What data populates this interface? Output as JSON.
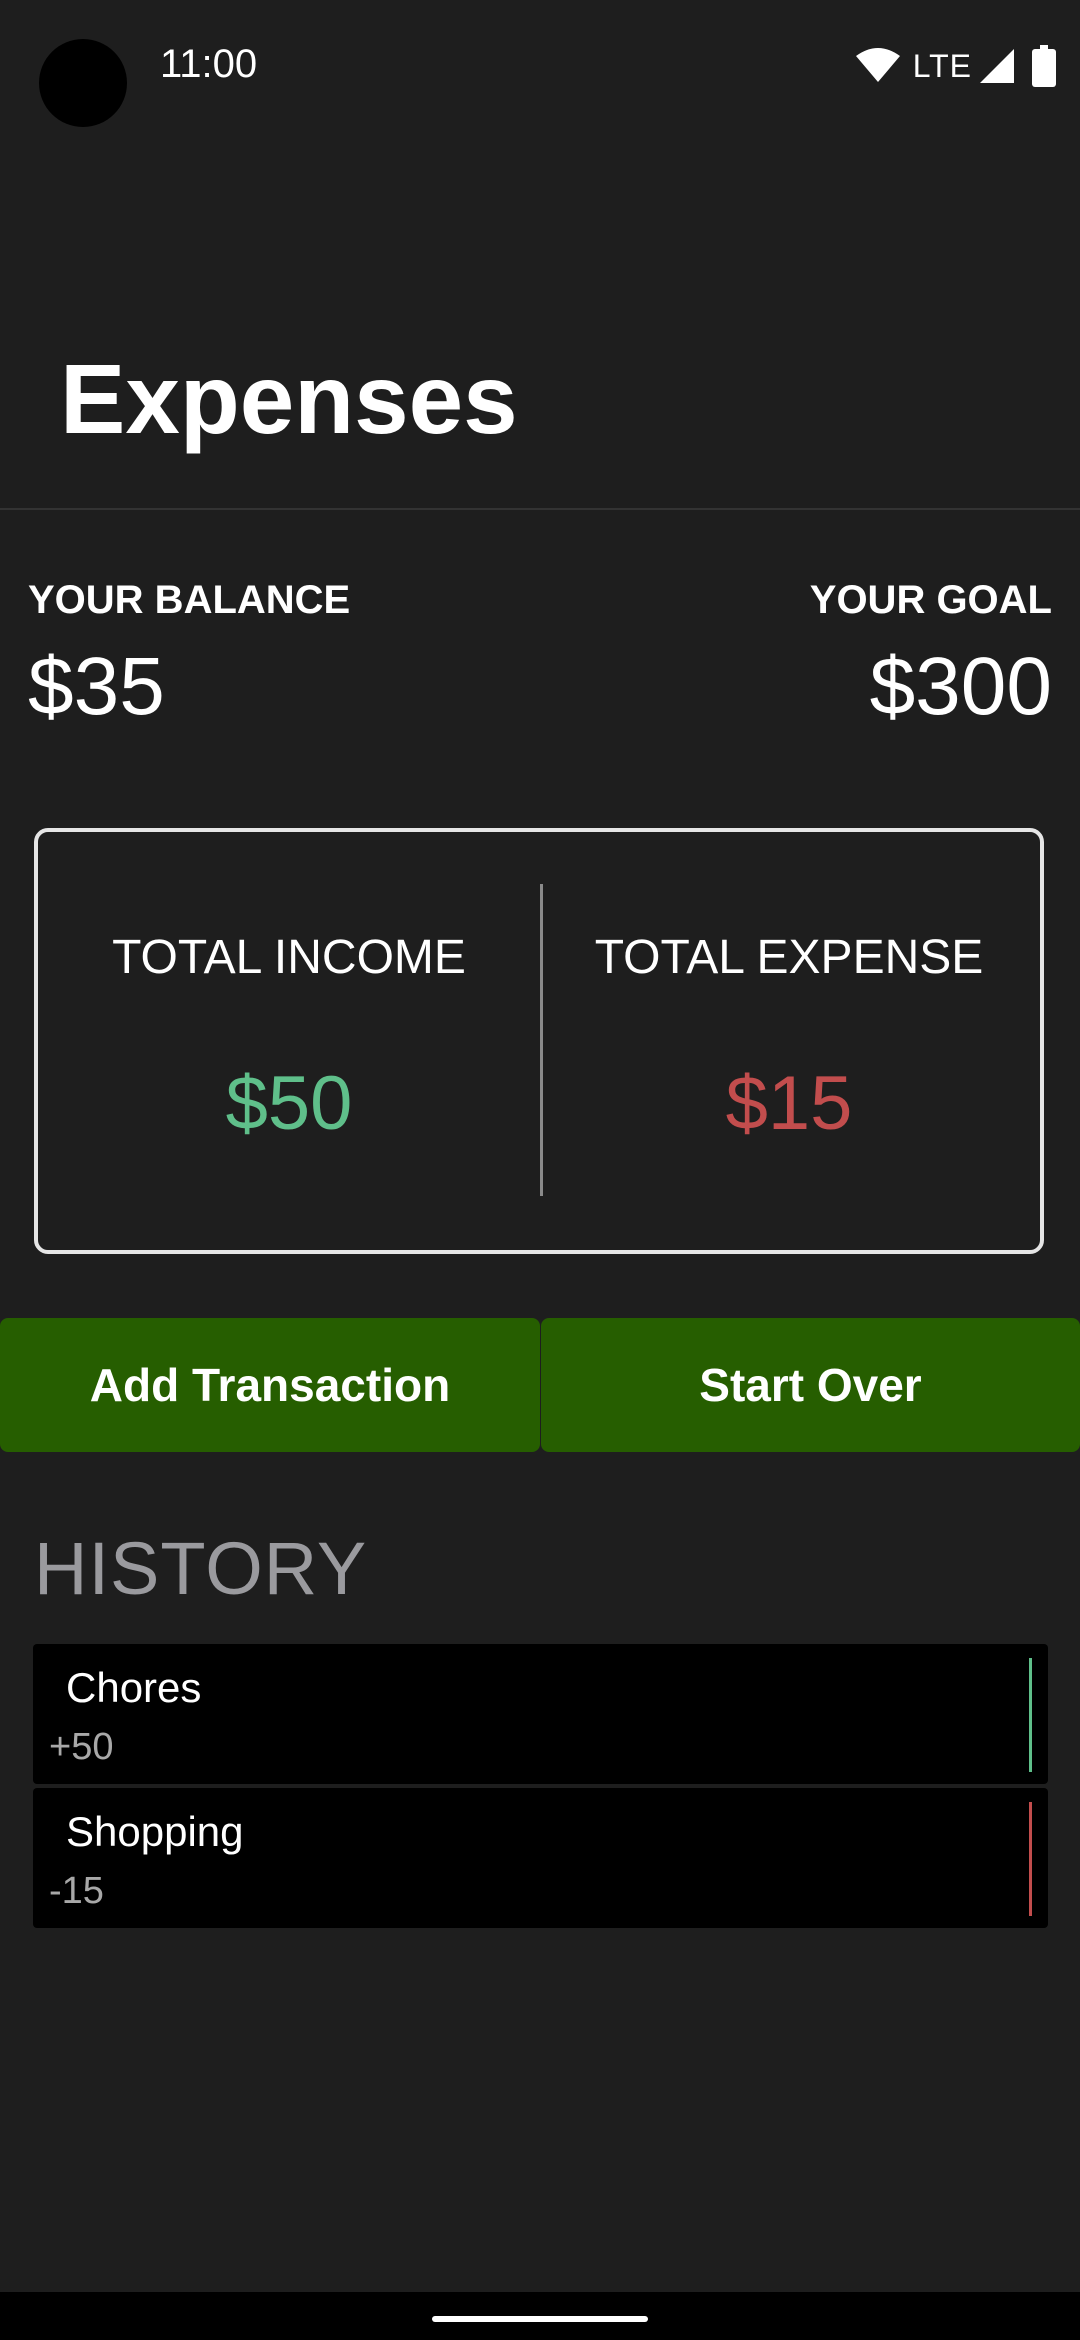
{
  "status_bar": {
    "time": "11:00",
    "network": "LTE",
    "icons": [
      "wifi-icon",
      "cell-signal-icon",
      "battery-icon"
    ]
  },
  "header": {
    "title": "Expenses"
  },
  "summary": {
    "balance_label": "YOUR BALANCE",
    "balance_value": "$35",
    "goal_label": "YOUR GOAL",
    "goal_value": "$300"
  },
  "totals": {
    "income_label": "TOTAL INCOME",
    "income_value": "$50",
    "expense_label": "TOTAL EXPENSE",
    "expense_value": "$15"
  },
  "actions": {
    "add_label": "Add Transaction",
    "start_over_label": "Start Over"
  },
  "history": {
    "heading": "HISTORY",
    "items": [
      {
        "title": "Chores",
        "amount": "+50",
        "type": "income"
      },
      {
        "title": "Shopping",
        "amount": "-15",
        "type": "expense"
      }
    ]
  },
  "colors": {
    "background": "#1e1e1e",
    "income": "#5fbf8a",
    "expense": "#c24d4d",
    "button": "#265e00",
    "history_heading": "#9a9a9e",
    "card_border": "#e6e6e6"
  }
}
